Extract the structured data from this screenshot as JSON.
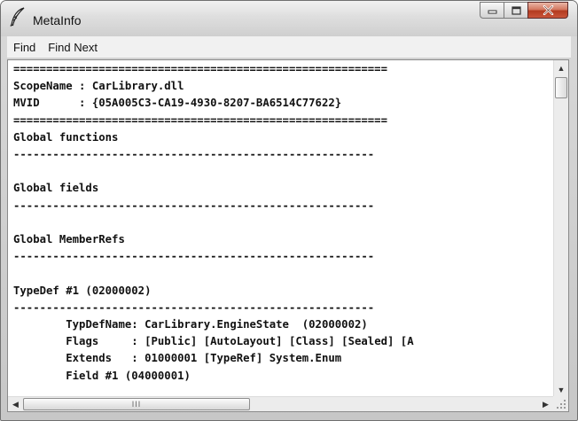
{
  "window": {
    "title": "MetaInfo",
    "minimize_icon": "minimize-icon",
    "maximize_icon": "maximize-icon",
    "close_icon": "close-icon",
    "close_color": "#c94a2f"
  },
  "menu": {
    "find": "Find",
    "find_next": "Find Next"
  },
  "content": {
    "lines": [
      "=========================================================",
      "ScopeName : CarLibrary.dll",
      "MVID      : {05A005C3-CA19-4930-8207-BA6514C77622}",
      "=========================================================",
      "Global functions",
      "-------------------------------------------------------",
      "",
      "Global fields",
      "-------------------------------------------------------",
      "",
      "Global MemberRefs",
      "-------------------------------------------------------",
      "",
      "TypeDef #1 (02000002)",
      "-------------------------------------------------------",
      "\tTypDefName: CarLibrary.EngineState  (02000002)",
      "\tFlags     : [Public] [AutoLayout] [Class] [Sealed] [A",
      "\tExtends   : 01000001 [TypeRef] System.Enum",
      "\tField #1 (04000001)"
    ]
  },
  "scrollbars": {
    "vertical_position": 0.02,
    "horizontal_position": 0.0,
    "hthumb_grip": "III"
  }
}
